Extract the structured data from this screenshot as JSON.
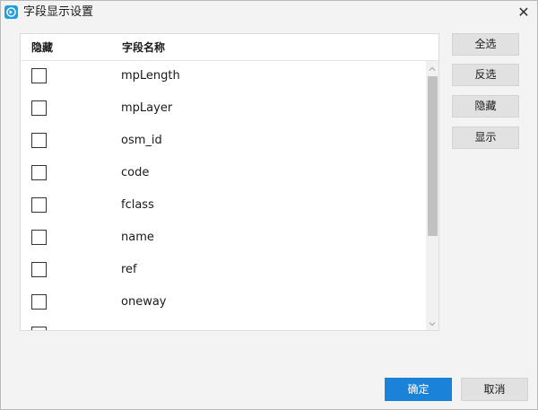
{
  "window": {
    "title": "字段显示设置",
    "app_icon": "app-logo-icon",
    "close_icon": "close-icon",
    "close_glyph": "✕"
  },
  "list": {
    "headers": {
      "hide": "隐藏",
      "name": "字段名称"
    },
    "fields": [
      {
        "name": "mpLength",
        "hidden": false
      },
      {
        "name": "mpLayer",
        "hidden": false
      },
      {
        "name": "osm_id",
        "hidden": false
      },
      {
        "name": "code",
        "hidden": false
      },
      {
        "name": "fclass",
        "hidden": false
      },
      {
        "name": "name",
        "hidden": false
      },
      {
        "name": "ref",
        "hidden": false
      },
      {
        "name": "oneway",
        "hidden": false
      },
      {
        "name": "",
        "hidden": false
      }
    ]
  },
  "side_buttons": {
    "select_all": "全选",
    "invert": "反选",
    "hide": "隐藏",
    "show": "显示"
  },
  "footer": {
    "ok": "确定",
    "cancel": "取消"
  },
  "colors": {
    "accent": "#1a83d9",
    "dialog_bg": "#f3f3f3",
    "button_bg": "#e1e1e1",
    "scroll_thumb": "#c1c1c1"
  }
}
